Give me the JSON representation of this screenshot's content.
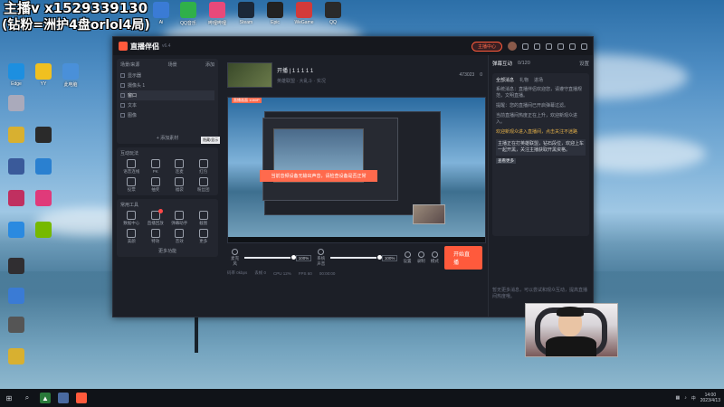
{
  "overlay": {
    "line1": "主播v x1529339130",
    "line2": "(钻粉=洲护4盘orlol4局)"
  },
  "desktop_icons": [
    {
      "label": "Ai",
      "name": "ai-icon",
      "color": "#3a7bd5"
    },
    {
      "label": "QQ音乐",
      "name": "qq-music-icon",
      "color": "#30b04a"
    },
    {
      "label": "QQ",
      "name": "qq-icon",
      "color": "#2a2a2a"
    },
    {
      "label": "哔哩哔哩",
      "name": "bilibili-icon",
      "color": "#e8497a"
    },
    {
      "label": "Edge",
      "name": "edge-icon",
      "color": "#1d8fe0"
    },
    {
      "label": "Steam",
      "name": "steam-icon",
      "color": "#1b2838"
    },
    {
      "label": "Epic",
      "name": "epic-icon",
      "color": "#222"
    },
    {
      "label": "WeGame",
      "name": "wegame-icon",
      "color": "#d23a3a"
    },
    {
      "label": "YY",
      "name": "yy-icon",
      "color": "#f0c020"
    },
    {
      "label": "NVIDIA",
      "name": "nvidia-icon",
      "color": "#76b900"
    },
    {
      "label": "OBS",
      "name": "obs-icon",
      "color": "#302e31"
    },
    {
      "label": "此电脑",
      "name": "this-pc-icon",
      "color": "#4a90d9"
    }
  ],
  "app": {
    "name": "直播伴侣",
    "version": "v6.4",
    "live_pill": "主播中心",
    "left": {
      "scenes_header": "场景/来源",
      "scenes_tabs": [
        "场景",
        "添加"
      ],
      "scenes": [
        {
          "label": "显示器"
        },
        {
          "label": "摄像头 1"
        },
        {
          "label": "窗口"
        },
        {
          "label": "文本"
        },
        {
          "label": "图像"
        }
      ],
      "add_source": "+ 添加素材",
      "tooltip": "隐藏/显示",
      "interactive_header": "互动玩法",
      "interactive_tools": [
        "语音连线",
        "PK",
        "连麦",
        "红包",
        "投票",
        "抽奖",
        "福袋",
        "粉丝团"
      ],
      "common_header": "常用工具",
      "common_tools": [
        "数据中心",
        "直播回放",
        "弹幕助手",
        "截图",
        "美颜",
        "特效",
        "音效",
        "更多"
      ],
      "more": "更多功能"
    },
    "room": {
      "title": "开播 | 1 1 1 1 1",
      "meta": "英雄联盟 · 大乱斗 · 实况",
      "viewers": "473023",
      "likes": "0"
    },
    "preview": {
      "badge": "直播画面 1080P",
      "alert": "当前音频设备无输出声音，请检查设备是否正常"
    },
    "controls": {
      "mic_label": "麦克风",
      "mic_value": "100%",
      "speaker_label": "系统声音",
      "speaker_value": "100%",
      "settings_label": "设置",
      "record_label": "录制",
      "mode_label": "模式",
      "start_live": "开始直播"
    },
    "status": [
      "码率 0kbps",
      "丢帧 0",
      "CPU 12%",
      "FPS 60",
      "00:00:00"
    ],
    "right": {
      "header_title": "弹幕互动",
      "header_count": "0/120",
      "header_settings": "设置",
      "assistant_tabs": [
        "全部消息",
        "礼物",
        "进场"
      ],
      "msg1": "系统消息：直播伴侣欢迎您，请遵守直播规范，文明直播。",
      "msg2": "提醒：您的直播间已开启弹幕过滤。",
      "msg3": "当前直播间热度正在上升，欢迎新观众进入。",
      "highlight": "欢迎新观众进入直播间，点击关注不迷路",
      "box": "主播正在打英雄联盟，钻石段位，欢迎上车一起开黑，关注主播获取开黑资格。",
      "tag": "查看更多",
      "bottom": "暂无更多消息，可以尝试和观众互动，提高直播间热度哦。"
    }
  },
  "taskbar": {
    "time": "14:00",
    "date": "2023/4/13"
  }
}
